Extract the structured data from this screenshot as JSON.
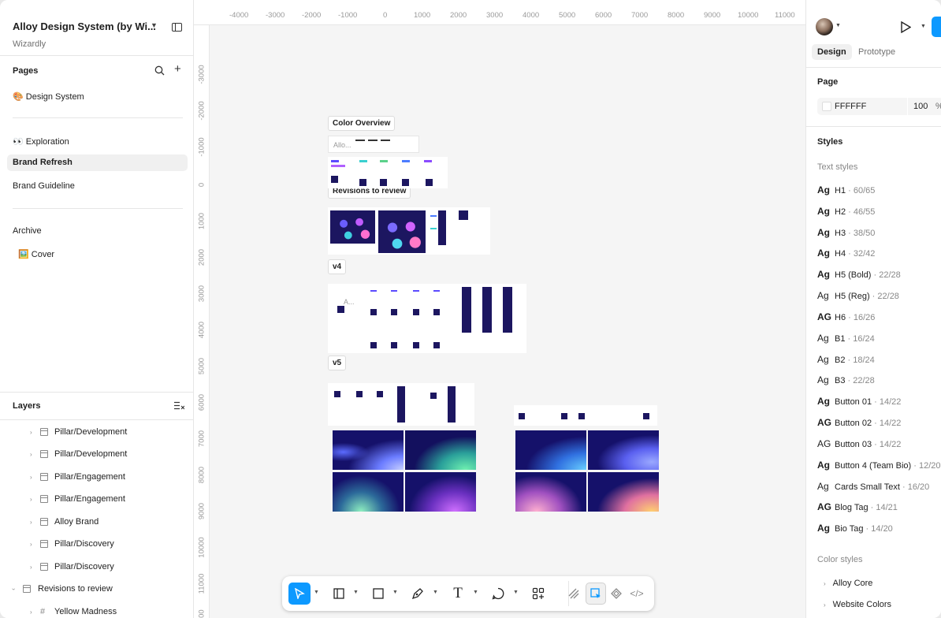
{
  "file": {
    "title": "Alloy Design System (by Wi...",
    "team": "Wizardly"
  },
  "pages": {
    "heading": "Pages",
    "items": [
      "🎨 Design System",
      "👀 Exploration",
      "Brand Refresh",
      "Brand Guideline",
      "Archive",
      "🖼️ Cover"
    ]
  },
  "layers": {
    "heading": "Layers",
    "items": [
      "Pillar/Development",
      "Pillar/Development",
      "Pillar/Engagement",
      "Pillar/Engagement",
      "Alloy Brand",
      "Pillar/Discovery",
      "Pillar/Discovery",
      "Revisions to review",
      "Yellow Madness"
    ]
  },
  "canvas": {
    "ruler_x": [
      "-4000",
      "-3000",
      "-2000",
      "-1000",
      "0",
      "1000",
      "2000",
      "3000",
      "4000",
      "5000",
      "6000",
      "7000",
      "8000",
      "9000",
      "10000",
      "11000"
    ],
    "ruler_y": [
      "-3000",
      "-2000",
      "-1000",
      "0",
      "1000",
      "2000",
      "3000",
      "4000",
      "5000",
      "6000",
      "7000",
      "8000",
      "9000",
      "10000",
      "11000",
      "12000"
    ],
    "labels": [
      "Color Overview",
      "Revisions to review",
      "v4",
      "v5"
    ],
    "mini_text": [
      "Allo...",
      "A..."
    ]
  },
  "right": {
    "tabs": [
      "Design",
      "Prototype"
    ],
    "page_heading": "Page",
    "page_color": "FFFFFF",
    "page_opacity": "100",
    "opacity_unit": "%",
    "styles_heading": "Styles",
    "text_styles_heading": "Text styles",
    "text_styles": [
      {
        "ag": "Ag",
        "name": "H1",
        "meta": " · 60/65"
      },
      {
        "ag": "Ag",
        "name": "H2",
        "meta": " · 46/55"
      },
      {
        "ag": "Ag",
        "name": "H3",
        "meta": " · 38/50"
      },
      {
        "ag": "Ag",
        "name": "H4",
        "meta": " · 32/42"
      },
      {
        "ag": "Ag",
        "name": "H5 (Bold)",
        "meta": " · 22/28"
      },
      {
        "ag": "Ag",
        "name": "H5 (Reg)",
        "meta": " · 22/28"
      },
      {
        "ag": "AG",
        "name": "H6",
        "meta": " · 16/26"
      },
      {
        "ag": "Ag",
        "name": "B1",
        "meta": " · 16/24"
      },
      {
        "ag": "Ag",
        "name": "B2",
        "meta": " · 18/24"
      },
      {
        "ag": "Ag",
        "name": "B3",
        "meta": " · 22/28"
      },
      {
        "ag": "Ag",
        "name": "Button 01",
        "meta": " · 14/22"
      },
      {
        "ag": "AG",
        "name": "Button 02",
        "meta": " · 14/22"
      },
      {
        "ag": "AG",
        "name": "Button 03",
        "meta": " · 14/22"
      },
      {
        "ag": "Ag",
        "name": "Button 4 (Team Bio)",
        "meta": " · 12/20"
      },
      {
        "ag": "Ag",
        "name": "Cards Small Text",
        "meta": " · 16/20"
      },
      {
        "ag": "AG",
        "name": "Blog Tag",
        "meta": " · 14/21"
      },
      {
        "ag": "Ag",
        "name": "Bio Tag",
        "meta": " · 14/20"
      }
    ],
    "color_styles_heading": "Color styles",
    "color_styles": [
      "Alloy Core",
      "Website Colors"
    ]
  },
  "colors": {
    "accent": "#0d99ff",
    "brand_dark": "#1c1660"
  }
}
